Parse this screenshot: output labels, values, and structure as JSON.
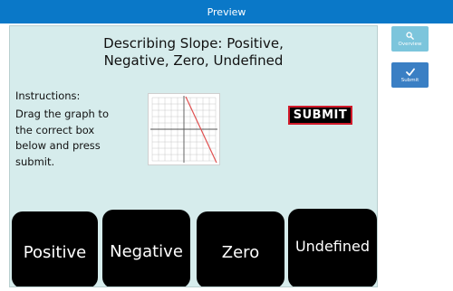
{
  "topbar": {
    "title": "Preview"
  },
  "slide": {
    "title_line1": "Describing Slope: Positive,",
    "title_line2": "Negative, Zero, Undefined",
    "instructions_label": "Instructions:",
    "instructions_text": "Drag the graph to the correct box below and press submit.",
    "submit_label": "SUBMIT",
    "drop_boxes": [
      {
        "label": "Positive"
      },
      {
        "label": "Negative"
      },
      {
        "label": "Zero"
      },
      {
        "label": "Undefined"
      }
    ]
  },
  "sidebar": {
    "overview": {
      "label": "Overview",
      "icon": "search-icon"
    },
    "submit": {
      "label": "Submit",
      "icon": "checkmark-icon"
    }
  },
  "colors": {
    "topbar": "#0a78c8",
    "slide_background": "#d6ecec",
    "submit_border": "#d11a2a",
    "overview_button": "#7cc5dc",
    "submit_button": "#3a7fc4",
    "graph_line": "#e05050"
  }
}
